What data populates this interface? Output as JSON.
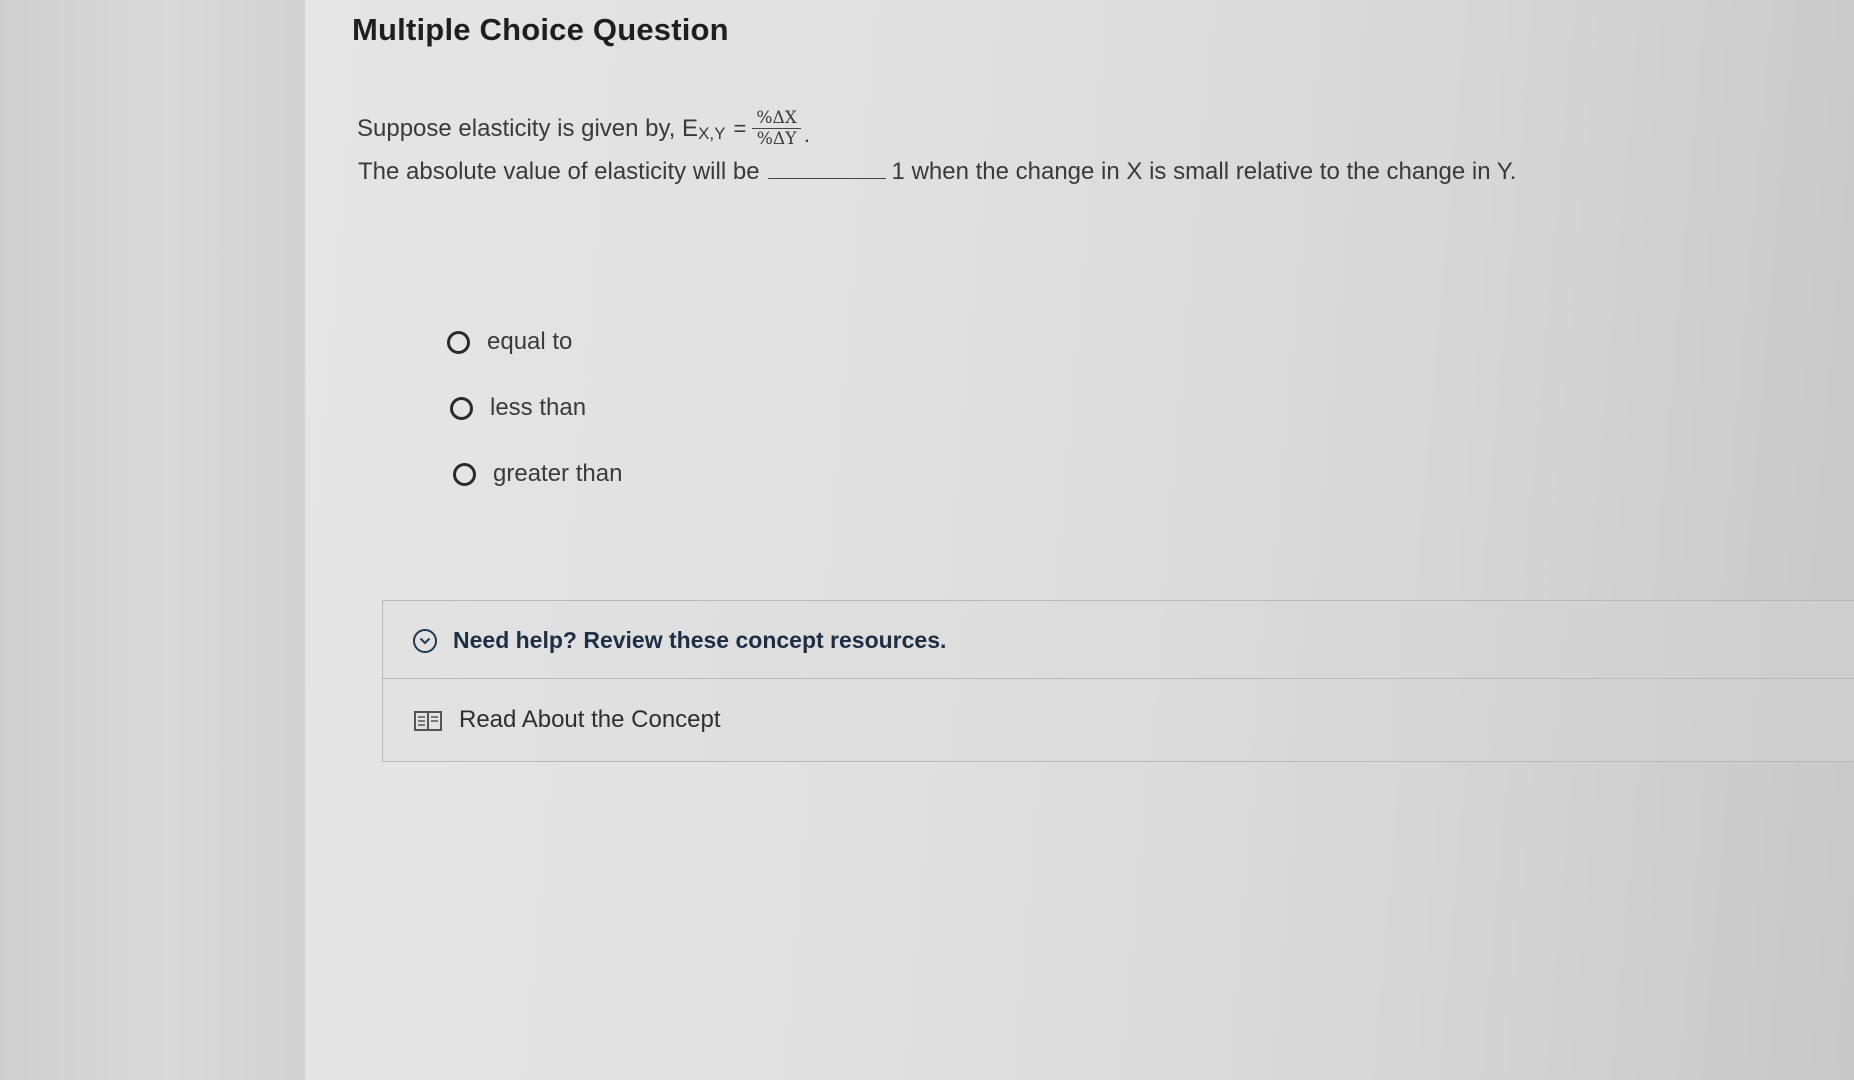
{
  "question": {
    "heading": "Multiple Choice Question",
    "stem_line1_prefix": "Suppose elasticity is given by, E",
    "stem_line1_subscript": "X,Y",
    "stem_line1_equals": "=",
    "fraction_numerator": "%ΔX",
    "fraction_denominator": "%ΔY",
    "stem_line1_end": ".",
    "stem_line2_before_blank": "The absolute value of elasticity will be",
    "stem_line2_after_blank": "1 when the change in X is small relative to the change in Y."
  },
  "options": [
    {
      "label": "equal to",
      "selected": false
    },
    {
      "label": "less than",
      "selected": false
    },
    {
      "label": "greater than",
      "selected": false
    }
  ],
  "help": {
    "toggle_icon": "chevron-down-circle-icon",
    "title": "Need help? Review these concept resources.",
    "resource_icon": "book-icon",
    "resource_label": "Read About the Concept"
  }
}
